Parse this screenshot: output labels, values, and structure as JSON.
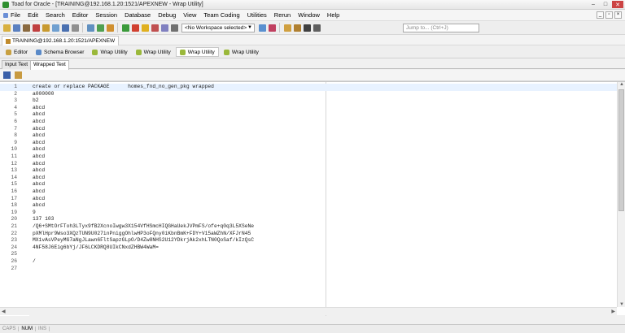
{
  "window": {
    "title": "Toad for Oracle - [TRAINING@192.168.1.20:1521/APEXNEW - Wrap Utility]"
  },
  "menu": {
    "items": [
      "File",
      "Edit",
      "Search",
      "Editor",
      "Session",
      "Database",
      "Debug",
      "View",
      "Team Coding",
      "Utilities",
      "Rerun",
      "Window",
      "Help"
    ]
  },
  "toolbar": {
    "workspace_selected": "<No Workspace selected>",
    "jump_placeholder": "Jump to... (Ctrl+J)"
  },
  "connection": {
    "tab_label": "TRAINING@192.168.1.20:1521/APEXNEW"
  },
  "window_tabs": [
    {
      "label": "Editor",
      "icon": "editor-icon",
      "color": "#c8a040"
    },
    {
      "label": "Schema Browser",
      "icon": "schema-browser-icon",
      "color": "#5a8ac8"
    },
    {
      "label": "Wrap Utility",
      "icon": "wrap-utility-icon",
      "color": "#9ab83a"
    },
    {
      "label": "Wrap Utility",
      "icon": "wrap-utility-icon",
      "color": "#9ab83a"
    },
    {
      "label": "Wrap Utility",
      "icon": "wrap-utility-icon",
      "color": "#9ab83a"
    },
    {
      "label": "Wrap Utility",
      "icon": "wrap-utility-icon",
      "color": "#9ab83a"
    }
  ],
  "sub_tabs": {
    "input": "Input Text",
    "wrapped": "Wrapped Text"
  },
  "editor": {
    "lines": [
      {
        "n": "1",
        "text": "create or replace PACKAGE      homes_fnd_no_gen_pkg wrapped"
      },
      {
        "n": "2",
        "text": "a000000"
      },
      {
        "n": "3",
        "text": "b2"
      },
      {
        "n": "4",
        "text": "abcd"
      },
      {
        "n": "5",
        "text": "abcd"
      },
      {
        "n": "6",
        "text": "abcd"
      },
      {
        "n": "7",
        "text": "abcd"
      },
      {
        "n": "8",
        "text": "abcd"
      },
      {
        "n": "9",
        "text": "abcd"
      },
      {
        "n": "10",
        "text": "abcd"
      },
      {
        "n": "11",
        "text": "abcd"
      },
      {
        "n": "12",
        "text": "abcd"
      },
      {
        "n": "13",
        "text": "abcd"
      },
      {
        "n": "14",
        "text": "abcd"
      },
      {
        "n": "15",
        "text": "abcd"
      },
      {
        "n": "16",
        "text": "abcd"
      },
      {
        "n": "17",
        "text": "abcd"
      },
      {
        "n": "18",
        "text": "abcd"
      },
      {
        "n": "19",
        "text": "9"
      },
      {
        "n": "20",
        "text": "137 103"
      },
      {
        "n": "21",
        "text": "/Q6+SMtOrFToh3LTyx9fB2XcnoIwgw3X154VfHSmcHIQGHaUekJVPmFS/ofe+q0q3L5XSeNe"
      },
      {
        "n": "22",
        "text": "pXMlHpr9Wso3XQzTUN9U027inPniggOhlwHP3oFQny0iKbnBmK+FDY+V15aWZhN/XFJrN45"
      },
      {
        "n": "23",
        "text": "MX1vAsVPeyMG7aNgJLawn6FltSapzGLpO/D4Zw8NHS2U12YDkrjAk2xhLTN0QoSaf/kIzQsC"
      },
      {
        "n": "24",
        "text": "4NF58J6Eig6bYj/JF6LCKDRQ8UIkCNxdZHBW4WaM="
      },
      {
        "n": "25",
        "text": ""
      },
      {
        "n": "26",
        "text": "/"
      },
      {
        "n": "27",
        "text": ""
      }
    ]
  },
  "status": {
    "caps": "CAPS",
    "num": "NUM",
    "ins": "INS"
  }
}
